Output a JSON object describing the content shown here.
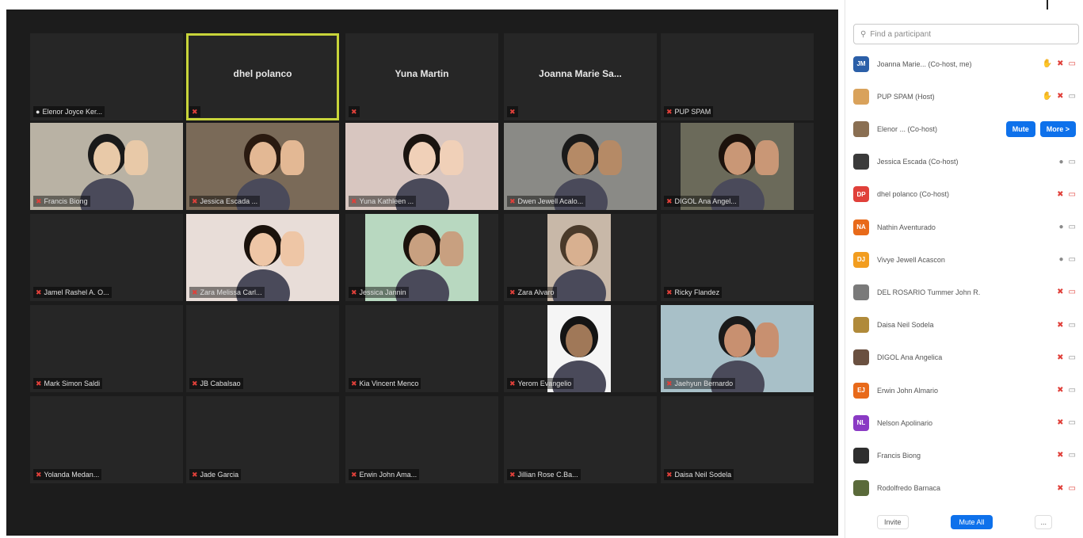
{
  "gallery": {
    "tiles": [
      {
        "label": "Elenor Joyce Ker...",
        "name_big": "",
        "mic": "on"
      },
      {
        "label": "",
        "name_big": "dhel polanco",
        "mic": "off"
      },
      {
        "label": "",
        "name_big": "Yuna Martin",
        "mic": "off"
      },
      {
        "label": "",
        "name_big": "Joanna Marie Sa...",
        "mic": "off"
      },
      {
        "label": "PUP SPAM",
        "name_big": "",
        "mic": "off"
      },
      {
        "label": "Francis Biong",
        "name_big": "",
        "mic": "off"
      },
      {
        "label": "Jessica Escada ...",
        "name_big": "",
        "mic": "off"
      },
      {
        "label": "Yuna Kathleen ...",
        "name_big": "",
        "mic": "off"
      },
      {
        "label": "Dwen Jewell Acalo...",
        "name_big": "",
        "mic": "off"
      },
      {
        "label": "DIGOL Ana Angel...",
        "name_big": "",
        "mic": "off"
      },
      {
        "label": "Jamel Rashel A. O...",
        "name_big": "",
        "mic": "off"
      },
      {
        "label": "Zara Melissa Carl...",
        "name_big": "",
        "mic": "off"
      },
      {
        "label": "Jessica Jannin",
        "name_big": "",
        "mic": "off"
      },
      {
        "label": "Zara Alvaro",
        "name_big": "",
        "mic": "off"
      },
      {
        "label": "Ricky Flandez",
        "name_big": "",
        "mic": "off"
      },
      {
        "label": "Mark Simon Saldi",
        "name_big": "",
        "mic": "off"
      },
      {
        "label": "JB Cabalsao",
        "name_big": "",
        "mic": "off"
      },
      {
        "label": "Kia Vincent Menco",
        "name_big": "",
        "mic": "off"
      },
      {
        "label": "Yerom Evangelio",
        "name_big": "",
        "mic": "off"
      },
      {
        "label": "Jaehyun Bernardo",
        "name_big": "",
        "mic": "off"
      },
      {
        "label": "Yolanda Medan...",
        "name_big": "",
        "mic": "off"
      },
      {
        "label": "Jade Garcia",
        "name_big": "",
        "mic": "off"
      },
      {
        "label": "Erwin John Ama...",
        "name_big": "",
        "mic": "off"
      },
      {
        "label": "Jillian Rose C.Ba...",
        "name_big": "",
        "mic": "off"
      },
      {
        "label": "Daisa Neil Sodela",
        "name_big": "",
        "mic": "off"
      }
    ]
  },
  "panel": {
    "search_placeholder": "Find a participant",
    "participants": [
      {
        "name": "Joanna Marie... (Co-host, me)",
        "initials": "JM",
        "avatar_color": "#2b5fa8",
        "icons": [
          "hand-icon",
          "mic-off-icon",
          "cam-off-icon"
        ]
      },
      {
        "name": "PUP SPAM (Host)",
        "initials": "",
        "avatar_color": "#d9a25b",
        "icons": [
          "hand-icon",
          "mic-off-icon",
          "cam-icon"
        ]
      },
      {
        "name": "Elenor ... (Co-host)",
        "initials": "",
        "avatar_color": "#8a6f52",
        "buttons": [
          "Mute",
          "More >"
        ]
      },
      {
        "name": "Jessica Escada (Co-host)",
        "initials": "",
        "avatar_color": "#3a3a3a",
        "icons": [
          "mic-icon",
          "cam-icon"
        ]
      },
      {
        "name": "dhel polanco (Co-host)",
        "initials": "DP",
        "avatar_color": "#e0403a",
        "icons": [
          "mic-off-icon",
          "cam-off-icon"
        ]
      },
      {
        "name": "Nathin Aventurado",
        "initials": "NA",
        "avatar_color": "#e86a1a",
        "icons": [
          "mic-icon",
          "cam-icon"
        ]
      },
      {
        "name": "Vivye Jewell Acascon",
        "initials": "DJ",
        "avatar_color": "#f29d1f",
        "icons": [
          "mic-icon",
          "cam-icon"
        ]
      },
      {
        "name": "DEL ROSARIO Tummer John R.",
        "initials": "",
        "avatar_color": "#7a7a7a",
        "icons": [
          "mic-off-icon",
          "cam-off-icon"
        ]
      },
      {
        "name": "Daisa Neil Sodela",
        "initials": "",
        "avatar_color": "#b08a3a",
        "icons": [
          "mic-off-icon",
          "cam-icon"
        ]
      },
      {
        "name": "DIGOL Ana Angelica",
        "initials": "",
        "avatar_color": "#6a5040",
        "icons": [
          "mic-off-icon",
          "cam-icon"
        ]
      },
      {
        "name": "Erwin John Almario",
        "initials": "EJ",
        "avatar_color": "#e86a1a",
        "icons": [
          "mic-off-icon",
          "cam-icon"
        ]
      },
      {
        "name": "Nelson Apolinario",
        "initials": "NL",
        "avatar_color": "#8a3ac4",
        "icons": [
          "mic-off-icon",
          "cam-icon"
        ]
      },
      {
        "name": "Francis Biong",
        "initials": "",
        "avatar_color": "#2e2e2e",
        "icons": [
          "mic-off-icon",
          "cam-icon"
        ]
      },
      {
        "name": "Rodolfredo Barnaca",
        "initials": "",
        "avatar_color": "#5a6a3a",
        "icons": [
          "mic-off-icon",
          "cam-off-icon"
        ]
      }
    ],
    "footer": {
      "invite": "Invite",
      "mute_all": "Mute All",
      "more": "..."
    }
  }
}
